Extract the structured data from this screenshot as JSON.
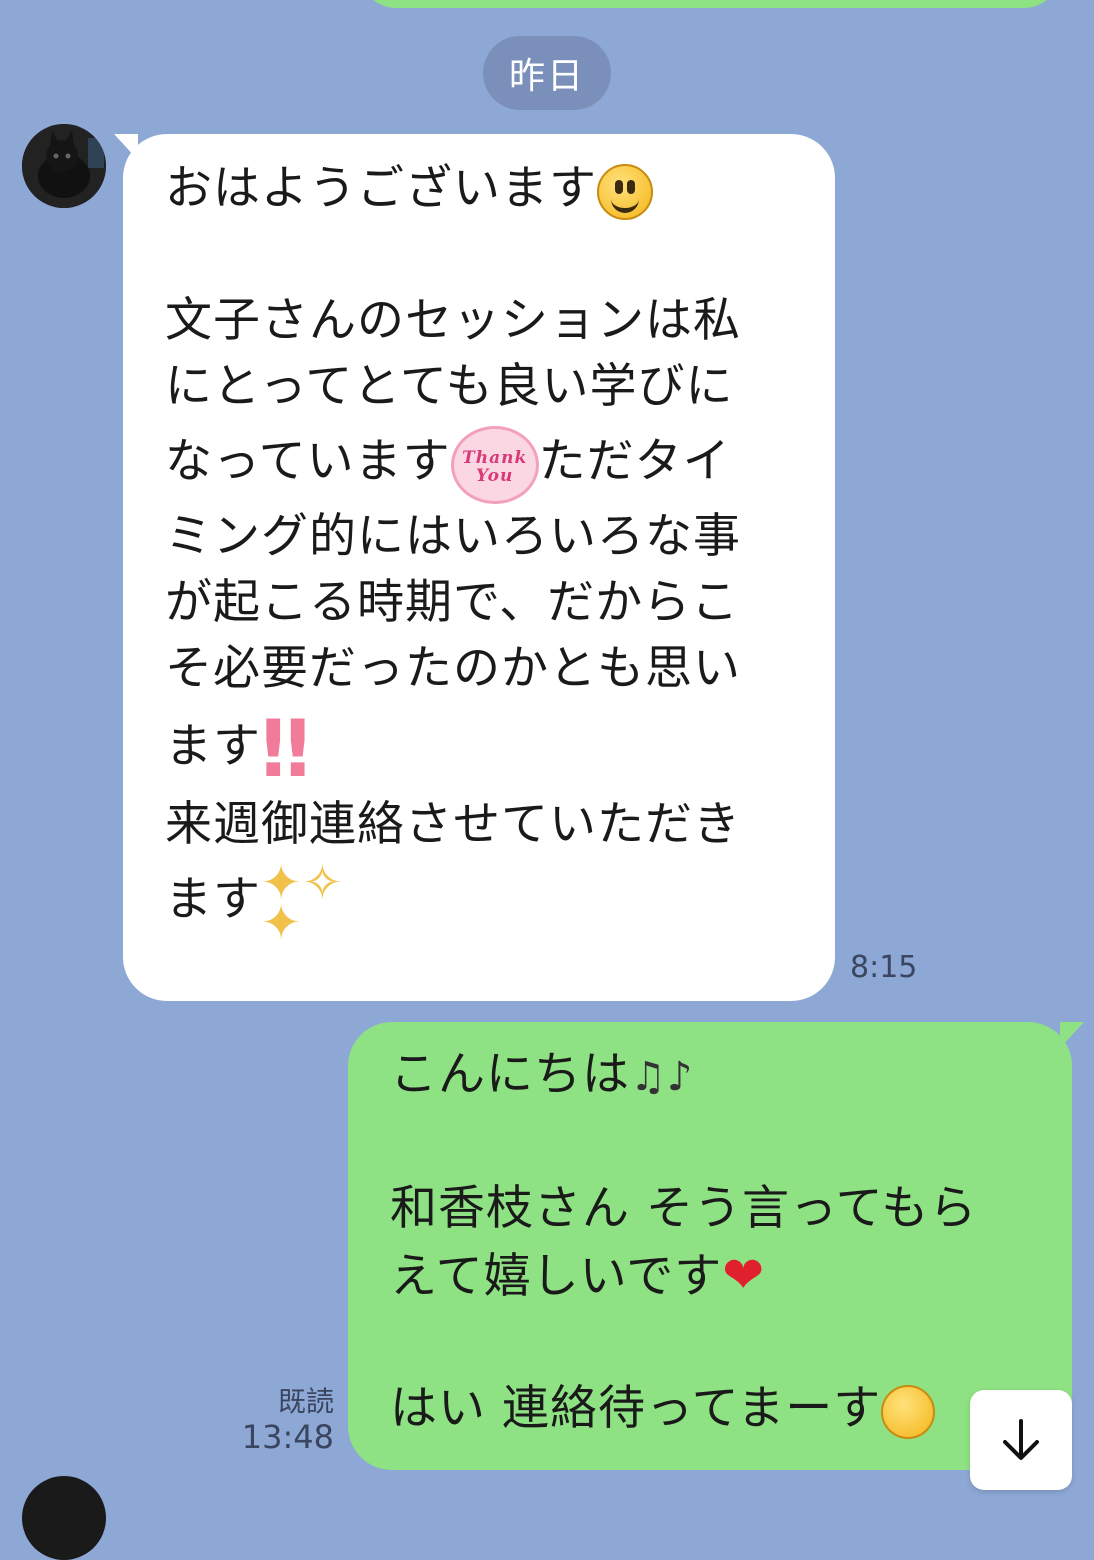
{
  "date_separator": "昨日",
  "incoming": {
    "lines": [
      "おはようございます",
      "文子さんのセッションは私",
      "にとってとても良い学びに",
      "なっています",
      "ただタイ",
      "ミング的にはいろいろな事",
      "が起こる時期で、だからこ",
      "そ必要だったのかとも思い",
      "ます",
      "来週御連絡させていただき",
      "ます"
    ],
    "sticker_thank_you": "Thank You",
    "time": "8:15"
  },
  "outgoing": {
    "lines": [
      "こんにちは",
      "和香枝さん そう言ってもら",
      "えて嬉しいです",
      "はい 連絡待ってまーす"
    ],
    "read_label": "既読",
    "time": "13:48"
  },
  "icons": {
    "smiley": "grinning-face-icon",
    "thank_you": "thank-you-sticker-icon",
    "exclamation": "double-exclamation-icon",
    "sparkles": "sparkles-icon",
    "notes": "music-notes-icon",
    "heart": "red-heart-icon",
    "blush": "smiling-face-icon",
    "scroll": "arrow-down-icon"
  },
  "colors": {
    "background": "#8ea8d6",
    "incoming_bubble": "#ffffff",
    "outgoing_bubble": "#8fe284",
    "date_chip": "#7a90bb"
  }
}
